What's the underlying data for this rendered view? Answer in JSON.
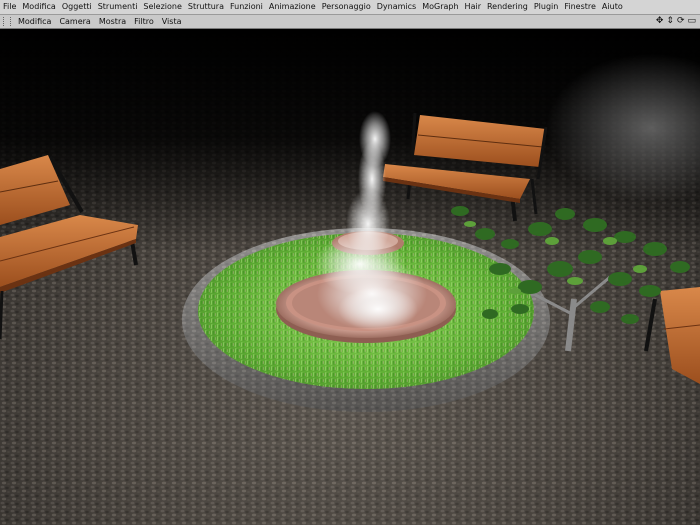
{
  "menubar": {
    "items": [
      "File",
      "Modifica",
      "Oggetti",
      "Strumenti",
      "Selezione",
      "Struttura",
      "Funzioni",
      "Animazione",
      "Personaggio",
      "Dynamics",
      "MoGraph",
      "Hair",
      "Rendering",
      "Plugin",
      "Finestre",
      "Aiuto"
    ]
  },
  "viewbar": {
    "items": [
      "Modifica",
      "Camera",
      "Mostra",
      "Filtro",
      "Vista"
    ]
  },
  "nav_icons": [
    "move-view-icon",
    "dolly-view-icon",
    "rotate-view-icon",
    "maximize-view-icon"
  ],
  "viewport": {
    "scene": "rendered-3d-scene",
    "colors": {
      "grass": "#6cbf3c",
      "bench_wood": "#b8632b",
      "basin": "#c9958a",
      "stone_rim": "#8a8a8a",
      "ground": "#3e3a36"
    }
  }
}
